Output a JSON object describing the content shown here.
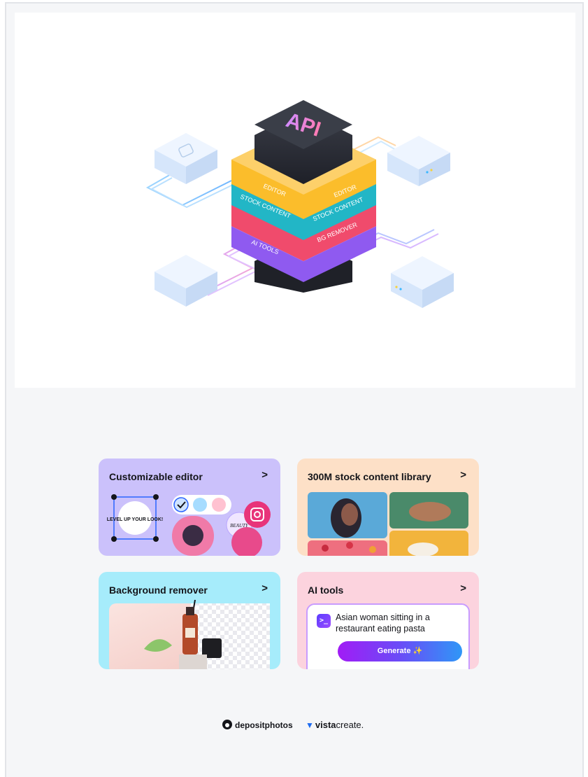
{
  "hero": {
    "center_label": "API",
    "layers": {
      "editor": "EDITOR",
      "stock": "STOCK CONTENT",
      "bg": "BG REMOVER",
      "ai": "AI TOOLS"
    },
    "colors": {
      "editor": "#fbbd2b",
      "stock": "#22b6c6",
      "bg": "#f04b6c",
      "ai": "#8f5af0",
      "top": "#2c2f38"
    }
  },
  "cards": {
    "editor": {
      "title": "Customizable editor",
      "arrow": ">",
      "sticker_text": "LEVEL UP YOUR LOOK!",
      "badge_text": "BEAUTY",
      "color": "#cbc1fb"
    },
    "stock": {
      "title": "300M stock content library",
      "arrow": ">",
      "color": "#fde0c7"
    },
    "bg": {
      "title": "Background remover",
      "arrow": ">",
      "color": "#a6ecfb"
    },
    "ai": {
      "title": "AI tools",
      "arrow": ">",
      "prompt": "Asian woman sitting in a restaurant eating pasta",
      "generate_label": "Generate ✨",
      "color": "#fcd3de"
    }
  },
  "footer": {
    "brand1": "depositphotos",
    "brand2_bold": "vista",
    "brand2_rest": "create."
  }
}
